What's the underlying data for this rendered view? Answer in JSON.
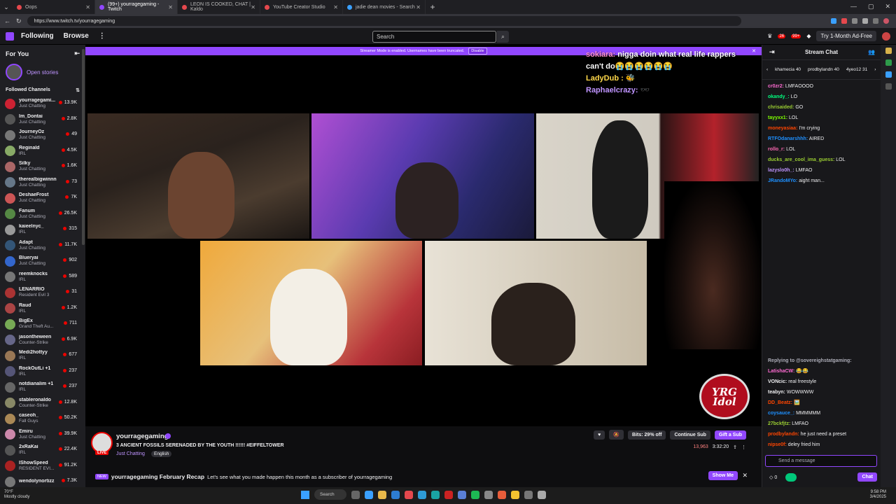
{
  "browser": {
    "tabs": [
      {
        "label": "Oops",
        "color": "#e5484d",
        "active": false
      },
      {
        "label": "(99+) yourragegaming - Twitch",
        "color": "#9147ff",
        "active": true
      },
      {
        "label": "LEON IS COOKED, CHAT | Kaldo",
        "color": "#e5484d",
        "active": false
      },
      {
        "label": "YouTube Creator Studio",
        "color": "#e5484d",
        "active": false
      },
      {
        "label": "jadie dean movies - Search",
        "color": "#3aa0ff",
        "active": false
      }
    ],
    "url": "https://www.twitch.tv/yourragegaming",
    "new_tab": "+"
  },
  "twitch_nav": {
    "following": "Following",
    "browse": "Browse",
    "more": "⋮",
    "search_placeholder": "Search",
    "notif_badge": "26",
    "whisper_badge": "99+",
    "ad_free": "Try 1-Month Ad-Free"
  },
  "sidebar": {
    "for_you": "For You",
    "collapse": "⇤",
    "open_stories": "Open stories",
    "followed_channels": "Followed Channels",
    "sort": "⇅",
    "channels": [
      {
        "name": "yourragegami...",
        "game": "Just Chatting",
        "viewers": "13.9K",
        "color": "#c23"
      },
      {
        "name": "Im_Dontai",
        "game": "Just Chatting",
        "viewers": "2.8K",
        "color": "#555"
      },
      {
        "name": "JourneyOz",
        "game": "Just Chatting",
        "viewers": "49",
        "color": "#777"
      },
      {
        "name": "Reginald",
        "game": "IRL",
        "viewers": "4.5K",
        "color": "#8a6"
      },
      {
        "name": "Silky",
        "game": "Just Chatting",
        "viewers": "1.6K",
        "color": "#a66"
      },
      {
        "name": "therealbigwinnn",
        "game": "Just Chatting",
        "viewers": "73",
        "color": "#678"
      },
      {
        "name": "DeshaeFrost",
        "game": "Just Chatting",
        "viewers": "7K",
        "color": "#c55"
      },
      {
        "name": "Fanum",
        "game": "Just Chatting",
        "viewers": "26.5K",
        "color": "#584"
      },
      {
        "name": "kaieelnyc_",
        "game": "IRL",
        "viewers": "315",
        "color": "#999"
      },
      {
        "name": "Adapt",
        "game": "Just Chatting",
        "viewers": "11.7K",
        "color": "#357"
      },
      {
        "name": "Blueryai",
        "game": "Just Chatting",
        "viewers": "902",
        "color": "#36c"
      },
      {
        "name": "reemknocks",
        "game": "IRL",
        "viewers": "589",
        "color": "#777"
      },
      {
        "name": "LENARRIO",
        "game": "Resident Evil 3",
        "viewers": "31",
        "color": "#a33"
      },
      {
        "name": "Raud",
        "game": "IRL",
        "viewers": "1.2K",
        "color": "#a44"
      },
      {
        "name": "BigEx",
        "game": "Grand Theft Au...",
        "viewers": "711",
        "color": "#7a5"
      },
      {
        "name": "jasontheween",
        "game": "Counter-Strike",
        "viewers": "6.9K",
        "color": "#668"
      },
      {
        "name": "Medi2hottyy",
        "game": "IRL",
        "viewers": "677",
        "color": "#975"
      },
      {
        "name": "RockOutLi +1",
        "game": "IRL",
        "viewers": "237",
        "color": "#557"
      },
      {
        "name": "notdianalim +1",
        "game": "IRL",
        "viewers": "237",
        "color": "#666"
      },
      {
        "name": "stableronaldo",
        "game": "Counter-Strike",
        "viewers": "12.8K",
        "color": "#886"
      },
      {
        "name": "caseoh_",
        "game": "Fall Guys",
        "viewers": "50.2K",
        "color": "#a85"
      },
      {
        "name": "Emiru",
        "game": "Just Chatting",
        "viewers": "39.9K",
        "color": "#c8a"
      },
      {
        "name": "2xRaKai",
        "game": "IRL",
        "viewers": "22.4K",
        "color": "#555"
      },
      {
        "name": "IShowSpeed",
        "game": "RESIDENT EVI...",
        "viewers": "91.2K",
        "color": "#a22"
      },
      {
        "name": "wendolynortizz",
        "game": "",
        "viewers": "7.3K",
        "color": "#777"
      }
    ]
  },
  "player": {
    "banner_text": "Streamer Mode is enabled. Usernames have been truncated.",
    "banner_button": "Disable",
    "overlay_chat": [
      {
        "user": "sokiara:",
        "text": "nigga doin what real life rappers can't do😭😭😭😭😭😭"
      },
      {
        "user": "LadyDub :",
        "text": "🐝"
      },
      {
        "user": "Raphaelcrazy:",
        "text": "🕶️"
      }
    ],
    "logo_text": "YRG Idol"
  },
  "stream_info": {
    "channel": "yourragegaming",
    "live": "LIVE",
    "title": "3 ANCIENT FOSSILS SERENADED BY THE YOUTH !!!!!! #EIFFELTOWER",
    "category": "Just Chatting",
    "language": "English",
    "bits": "Bits: 29% off",
    "continue_sub": "Continue Sub",
    "gift_sub": "Gift a Sub",
    "viewers": "13,963",
    "uptime": "3:32:20",
    "recap_new": "NEW",
    "recap_title": "yourragegaming February Recap",
    "recap_text": "Let's see what you made happen this month as a subscriber of yourragegaming",
    "show_me": "Show Me"
  },
  "chat": {
    "header": "Stream Chat",
    "leaders": [
      {
        "name": "khamecia",
        "score": "40"
      },
      {
        "name": "prodbylandn",
        "score": "40"
      },
      {
        "name": "4yeo12",
        "score": "31"
      }
    ],
    "messages": [
      {
        "user": "cr0zr2:",
        "text": "LMFAOOOO",
        "color": "#ff6bd2"
      },
      {
        "user": "okandy_:",
        "text": "LO",
        "color": "#00ff7f"
      },
      {
        "user": "chrisaided:",
        "text": "GO",
        "color": "#9acd32"
      },
      {
        "user": "tayyxx1:",
        "text": "LOL",
        "color": "#7fff00"
      },
      {
        "user": "moneyasiaa:",
        "text": "I'm crying",
        "color": "#ff4500"
      },
      {
        "user": "RTFOdanarshhh:",
        "text": "AIRED",
        "color": "#1e90ff"
      },
      {
        "user": "rollo_r:",
        "text": "LOL",
        "color": "#ff69b4"
      },
      {
        "user": "ducks_are_cool_ima_guess:",
        "text": "LOL",
        "color": "#9acd32"
      },
      {
        "user": "lazyslo0h_:",
        "text": "LMFAO",
        "color": "#bf94ff"
      },
      {
        "user": "JRandoMYo:",
        "text": "aight man...",
        "color": "#1e90ff"
      }
    ],
    "messages_bottom": [
      {
        "user": "Replying to @sovereighstatgaming:",
        "text": "",
        "color": "#adadb8"
      },
      {
        "user": "LatishaCW:",
        "text": "😂😂",
        "color": "#ff6bd2"
      },
      {
        "user": "VONcic:",
        "text": "real freestyle",
        "color": "#efeff1"
      },
      {
        "user": "teabyn:",
        "text": "WOWWWW",
        "color": "#efeff1"
      },
      {
        "user": "DD_Beatz:",
        "text": "🖼️",
        "color": "#ff4500"
      },
      {
        "user": "coysauce_:",
        "text": "MMMMMM",
        "color": "#1e90ff"
      },
      {
        "user": "27bckfjtz:",
        "text": "LMFAO",
        "color": "#9acd32"
      },
      {
        "user": "prodbylandn:",
        "text": "he just need a preset",
        "color": "#ff4500"
      },
      {
        "user": "nipse0f:",
        "text": "deley fried him",
        "color": "#ff4500"
      }
    ],
    "input_placeholder": "Send a message",
    "points": "0",
    "chat_button": "Chat"
  },
  "taskbar": {
    "weather_temp": "70°F",
    "weather_desc": "Mostly cloudy",
    "search": "Search",
    "time": "9:58 PM",
    "date": "3/4/2025"
  }
}
